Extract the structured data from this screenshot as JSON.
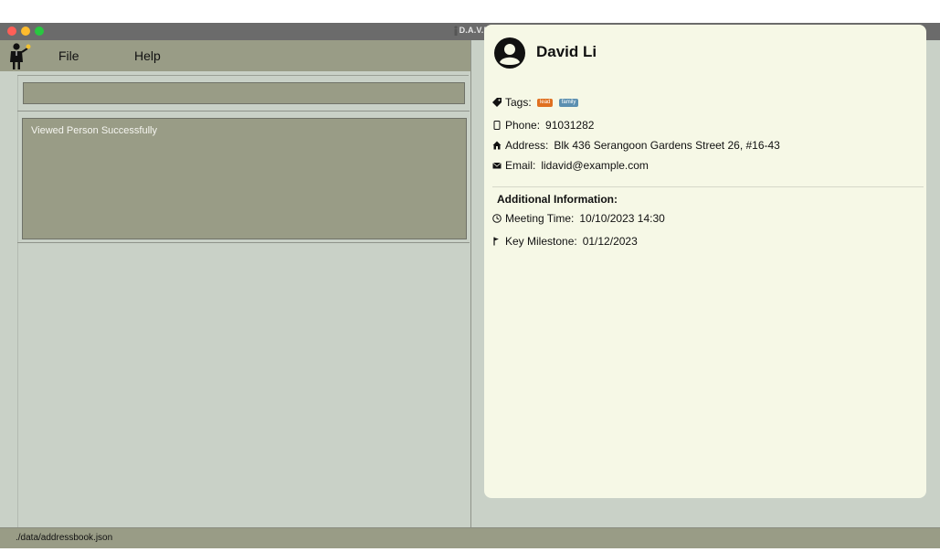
{
  "window": {
    "title": "D.A.V.E."
  },
  "menu": {
    "file": "File",
    "help": "Help"
  },
  "command": {
    "value": ""
  },
  "result": {
    "message": "Viewed Person Successfully"
  },
  "person": {
    "name": "David Li",
    "tags_label": "Tags:",
    "tags": [
      {
        "label": "lead",
        "color": "#e07020"
      },
      {
        "label": "family",
        "color": "#5b8fb0"
      }
    ],
    "phone_label": "Phone:",
    "phone": "91031282",
    "address_label": "Address:",
    "address": "Blk 436 Serangoon Gardens Street 26, #16-43",
    "email_label": "Email:",
    "email": "lidavid@example.com"
  },
  "additional": {
    "heading": "Additional Information:",
    "meeting_label": "Meeting Time:",
    "meeting": "10/10/2023 14:30",
    "milestone_label": "Key Milestone:",
    "milestone": "01/12/2023"
  },
  "status": {
    "path": "./data/addressbook.json"
  },
  "colors": {
    "menu_bg": "#999c86",
    "panel_bg": "#c9d1c7",
    "card_bg": "#f6f8e6"
  }
}
